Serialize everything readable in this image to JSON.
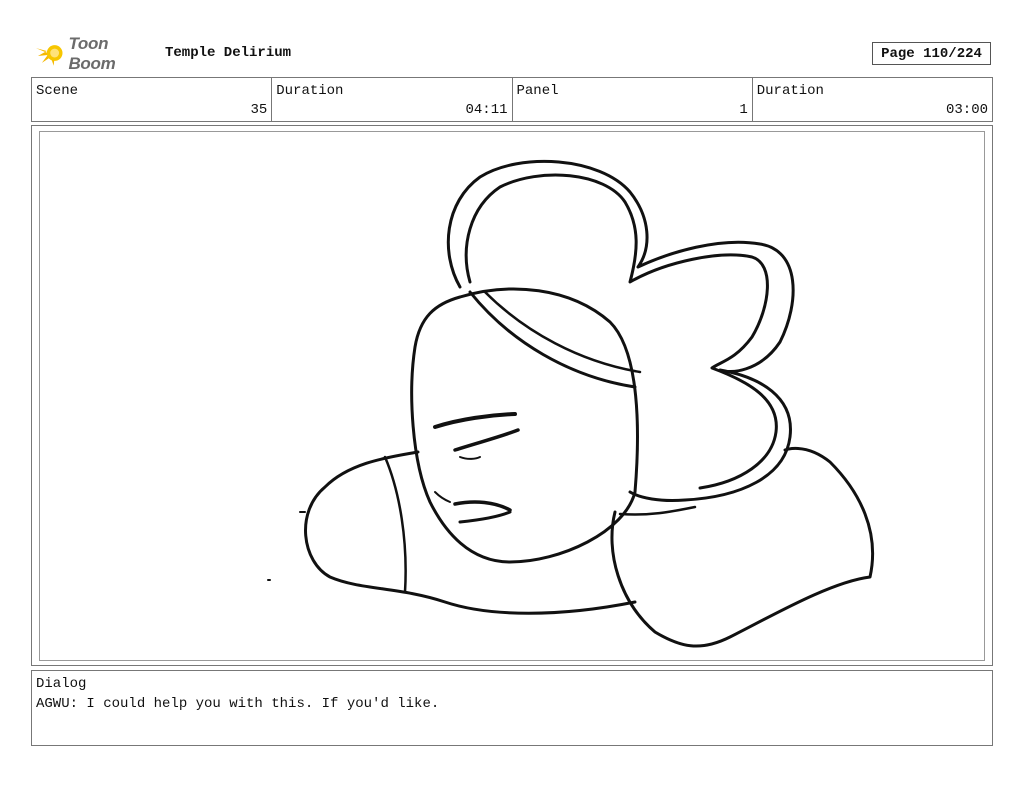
{
  "header": {
    "logo_text": "Toon Boom",
    "project_title": "Temple Delirium",
    "page_label": "Page 110/224"
  },
  "info": {
    "scene_label": "Scene",
    "scene_value": "35",
    "scene_duration_label": "Duration",
    "scene_duration_value": "04:11",
    "panel_label": "Panel",
    "panel_value": "1",
    "panel_duration_label": "Duration",
    "panel_duration_value": "03:00"
  },
  "dialog": {
    "label": "Dialog",
    "text": "AGWU: I could help you with this. If you'd like."
  },
  "colors": {
    "logo_accent": "#f5b800",
    "border": "#777777",
    "ink": "#111111"
  }
}
